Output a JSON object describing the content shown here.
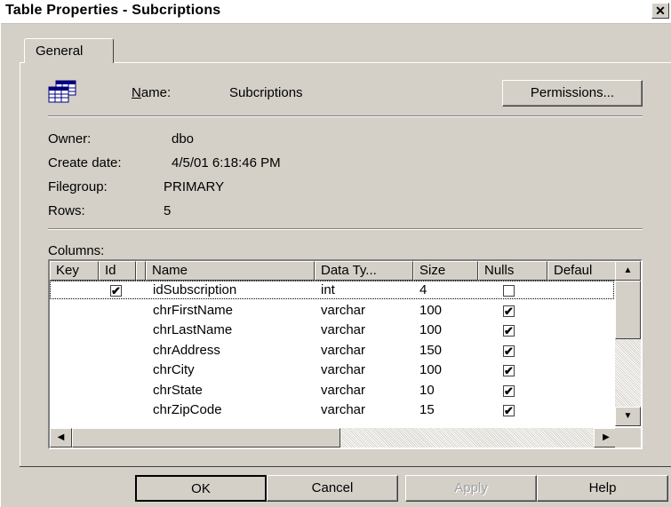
{
  "window": {
    "title": "Table Properties - Subcriptions",
    "close_glyph": "✕"
  },
  "tabs": [
    {
      "label": "General"
    }
  ],
  "general": {
    "name_label": "Name:",
    "name_accel": "N",
    "name_rest": "ame:",
    "name_value": "Subcriptions",
    "permissions_label": "Permissions...",
    "owner_label": "Owner:",
    "owner_value": "dbo",
    "create_label": "Create date:",
    "create_value": "4/5/01 6:18:46 PM",
    "filegroup_label": "Filegroup:",
    "filegroup_value": "PRIMARY",
    "rows_label": "Rows:",
    "rows_value": "5",
    "columns_label": "Columns:"
  },
  "grid": {
    "headers": [
      "Key",
      "Id",
      "Name",
      "Data Ty...",
      "Size",
      "Nulls",
      "Defaul"
    ],
    "rows": [
      {
        "id": true,
        "name": "idSubscription",
        "type": "int",
        "size": "4",
        "nulls": false
      },
      {
        "id": false,
        "name": "chrFirstName",
        "type": "varchar",
        "size": "100",
        "nulls": true
      },
      {
        "id": false,
        "name": "chrLastName",
        "type": "varchar",
        "size": "100",
        "nulls": true
      },
      {
        "id": false,
        "name": "chrAddress",
        "type": "varchar",
        "size": "150",
        "nulls": true
      },
      {
        "id": false,
        "name": "chrCity",
        "type": "varchar",
        "size": "100",
        "nulls": true
      },
      {
        "id": false,
        "name": "chrState",
        "type": "varchar",
        "size": "10",
        "nulls": true
      },
      {
        "id": false,
        "name": "chrZipCode",
        "type": "varchar",
        "size": "15",
        "nulls": true
      }
    ],
    "check_glyph": "✔"
  },
  "buttons": {
    "ok": "OK",
    "cancel": "Cancel",
    "apply": "Apply",
    "help": "Help"
  },
  "icons": {
    "table": "table-icon",
    "scroll_up": "▲",
    "scroll_down": "▼",
    "scroll_left": "◀",
    "scroll_right": "▶"
  },
  "colors": {
    "face": "#d4d0c8",
    "shadow": "#808080",
    "dark": "#404040",
    "disabled_text": "#a0a0a0"
  }
}
